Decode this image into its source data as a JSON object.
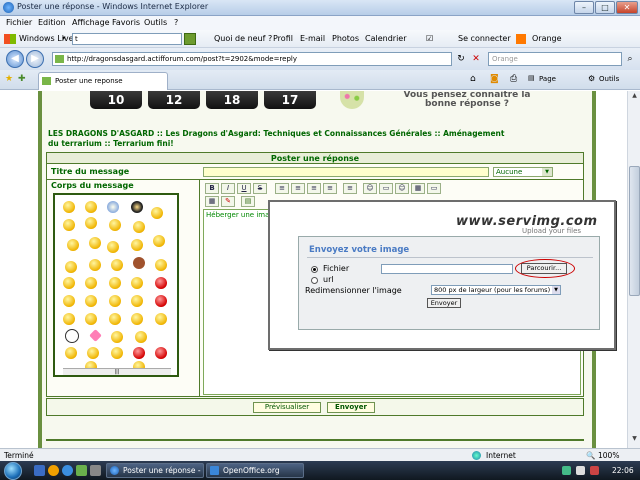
{
  "window": {
    "title": "Poster une réponse - Windows Internet Explorer",
    "min": "–",
    "max": "□",
    "close": "✕"
  },
  "menu": [
    "Fichier",
    "Edition",
    "Affichage",
    "Favoris",
    "Outils",
    "?"
  ],
  "livebar": {
    "brand": "Windows Live",
    "search_value": "t",
    "links": [
      "Quoi de neuf ?",
      "Profil",
      "E-mail",
      "Photos",
      "Calendrier",
      "Se connecter",
      "Orange"
    ]
  },
  "address": {
    "url": "http://dragonsdasgard.actifforum.com/post?t=2902&mode=reply",
    "search_placeholder": "Orange"
  },
  "tabs": {
    "active_label": "Poster une reponse",
    "page_cmd": "Page",
    "tools_cmd": "Outils"
  },
  "banner": {
    "numbers": [
      "10",
      "12",
      "18",
      "17"
    ],
    "question": "Vous pensez connaitre la bonne réponse ?"
  },
  "breadcrumb": "LES DRAGONS D'ASGARD  :: Les Dragons d'Asgard: Techniques et Connaissances Générales :: Aménagement du terrarium :: Terrarium fini!",
  "form": {
    "header": "Poster une réponse",
    "subject_label": "Titre du message",
    "body_label": "Corps du message",
    "icon_select": "Aucune",
    "host_link": "Héberger une image",
    "preview_button": "Prévisualiser",
    "send_button": "Envoyer",
    "toolbar": [
      "B",
      "I",
      "U",
      "S",
      "≡",
      "≡",
      "≡",
      "≡",
      "≡",
      "☺",
      "▭",
      "☺",
      "▦",
      "▭"
    ],
    "toolbar2": [
      "▦",
      "✎",
      "▤"
    ]
  },
  "popup": {
    "brand": "www.servimg.com",
    "tagline": "Upload your files",
    "heading": "Envoyez votre image",
    "file_label": "Fichier",
    "url_label": "url",
    "browse_button": "Parcourir...",
    "resize_label": "Redimensionner l'image",
    "resize_value": "800 px de largeur (pour les forums)",
    "send_button": "Envoyer"
  },
  "status": {
    "left": "Terminé",
    "zone": "Internet",
    "zoom": "100%"
  },
  "taskbar": {
    "tasks": [
      "Poster une réponse - ...",
      "OpenOffice.org"
    ],
    "clock": "22:06"
  }
}
